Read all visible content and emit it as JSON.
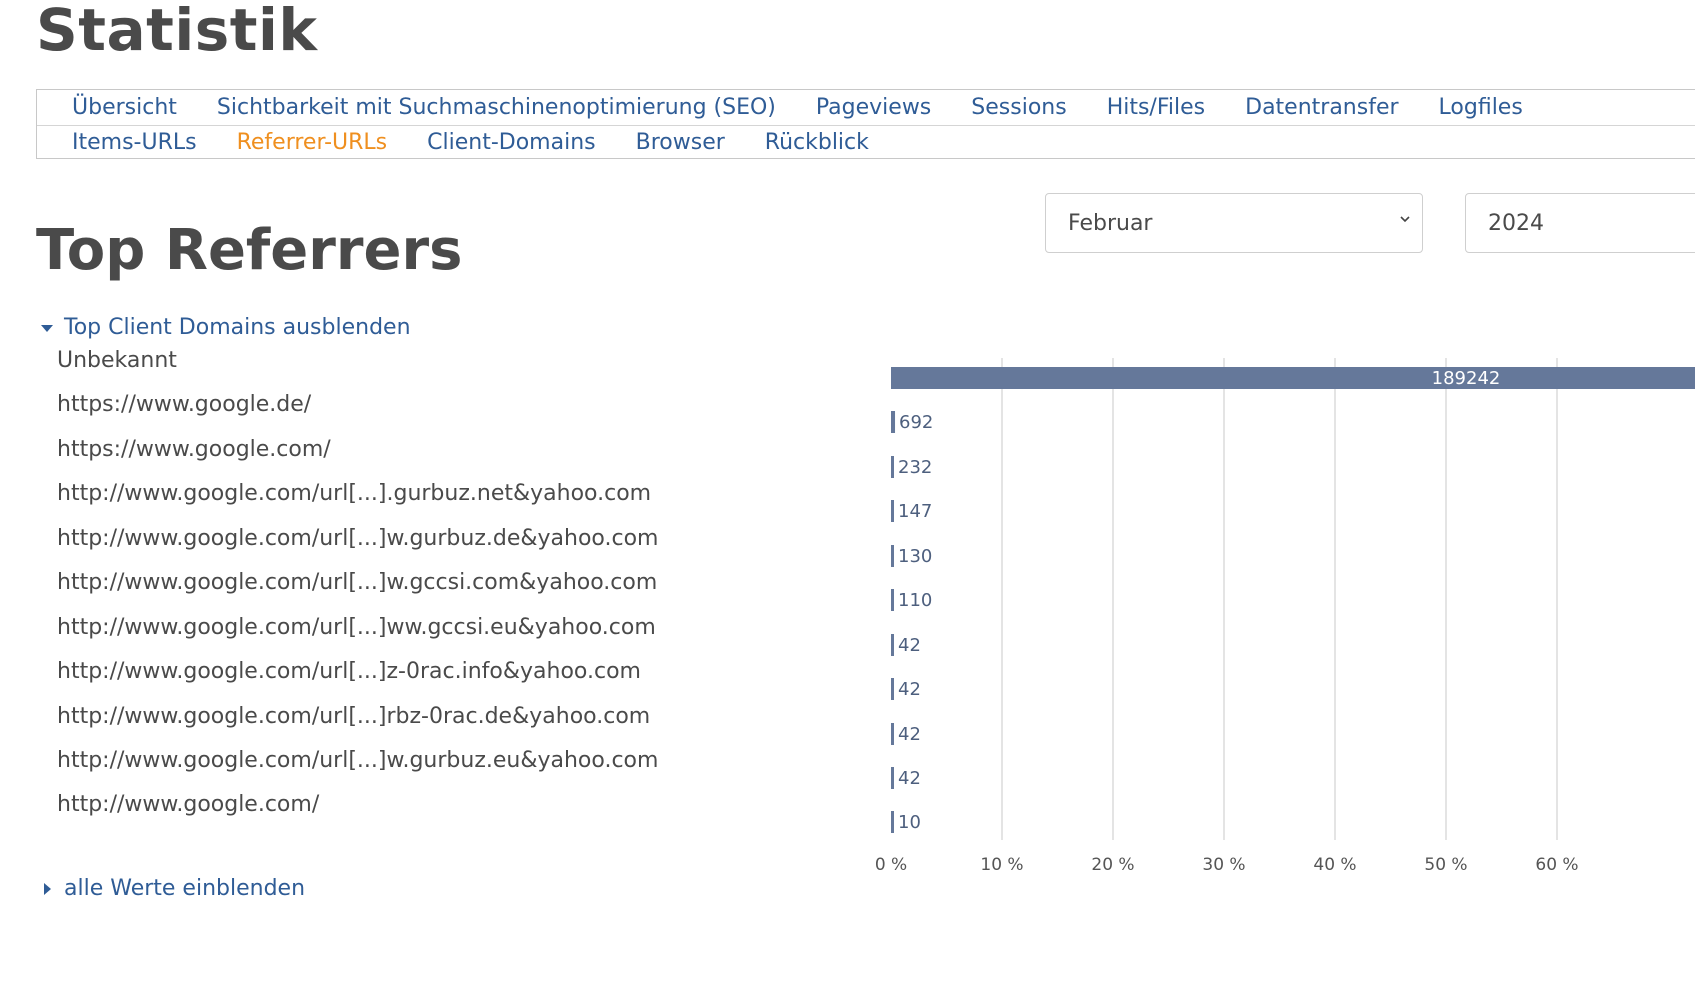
{
  "page_title": "Statistik",
  "tabs_row1": [
    {
      "label": "Übersicht",
      "active": false
    },
    {
      "label": "Sichtbarkeit mit Suchmaschinenoptimierung (SEO)",
      "active": false
    },
    {
      "label": "Pageviews",
      "active": false
    },
    {
      "label": "Sessions",
      "active": false
    },
    {
      "label": "Hits/Files",
      "active": false
    },
    {
      "label": "Datentransfer",
      "active": false
    },
    {
      "label": "Logfiles",
      "active": false
    }
  ],
  "tabs_row2": [
    {
      "label": "Items-URLs",
      "active": false
    },
    {
      "label": "Referrer-URLs",
      "active": true
    },
    {
      "label": "Client-Domains",
      "active": false
    },
    {
      "label": "Browser",
      "active": false
    },
    {
      "label": "Rückblick",
      "active": false
    }
  ],
  "filters": {
    "month": "Februar",
    "year": "2024"
  },
  "section_title": "Top Referrers",
  "collapse_toggle": "Top Client Domains ausblenden",
  "expand_toggle": "alle Werte einblenden",
  "colors": {
    "link": "#2f5c96",
    "active_tab": "#ef8f1f",
    "bar": "#65789a"
  },
  "chart_data": {
    "type": "bar",
    "orientation": "horizontal",
    "categories": [
      "Unbekannt",
      "https://www.google.de/",
      "https://www.google.com/",
      "http://www.google.com/url[...].gurbuz.net&yahoo.com",
      "http://www.google.com/url[...]w.gurbuz.de&yahoo.com",
      "http://www.google.com/url[...]w.gccsi.com&yahoo.com",
      "http://www.google.com/url[...]ww.gccsi.eu&yahoo.com",
      "http://www.google.com/url[...]z-0rac.info&yahoo.com",
      "http://www.google.com/url[...]rbz-0rac.de&yahoo.com",
      "http://www.google.com/url[...]w.gurbuz.eu&yahoo.com",
      "http://www.google.com/"
    ],
    "values": [
      189242,
      692,
      232,
      147,
      130,
      110,
      42,
      42,
      42,
      42,
      10
    ],
    "x_tick_labels": [
      "0 %",
      "10 %",
      "20 %",
      "30 %",
      "40 %",
      "50 %",
      "60 %"
    ],
    "x_unit": "percent of total",
    "xlim_percent": [
      0,
      60
    ],
    "grid": true
  }
}
